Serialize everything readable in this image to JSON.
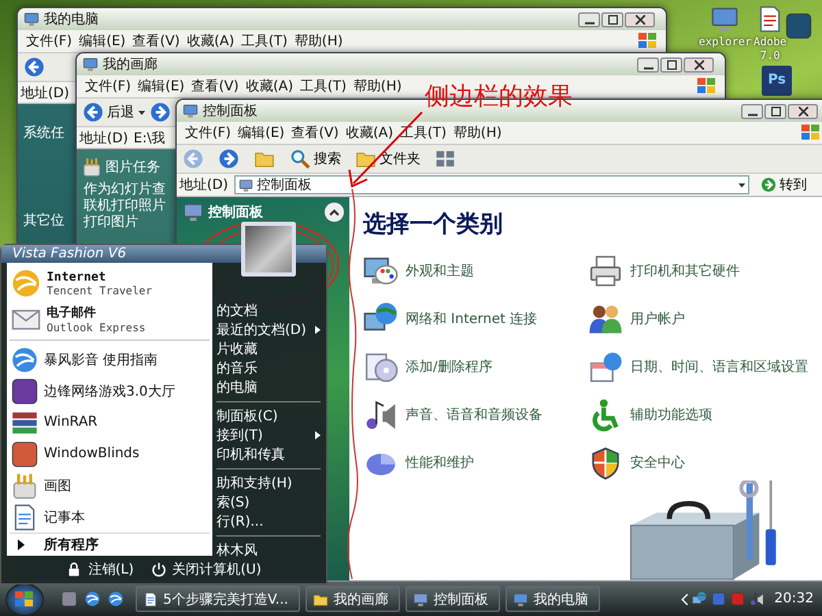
{
  "desktop_icons": [
    {
      "kind": "computer",
      "label": "explorer"
    },
    {
      "kind": "pdf",
      "label": "Adobe",
      "caption": "7.0"
    },
    {
      "kind": "feather"
    },
    {
      "kind": "photoshop",
      "badge": "Ps"
    }
  ],
  "my_computer_window": {
    "title": "我的电脑",
    "menu": [
      "文件(F)",
      "编辑(E)",
      "查看(V)",
      "收藏(A)",
      "工具(T)",
      "帮助(H)"
    ],
    "address_label": "地址(D)",
    "sections": [
      "系统任",
      "其它位"
    ]
  },
  "gallery_window": {
    "title": "我的画廊",
    "menu": [
      "文件(F)",
      "编辑(E)",
      "查看(V)",
      "收藏(A)",
      "工具(T)",
      "帮助(H)"
    ],
    "back_label": "后退",
    "address_label": "地址(D)",
    "address_value": "E:\\我",
    "task_title": "图片任务",
    "tasks": [
      "作为幻灯片查",
      "联机打印照片",
      "打印图片"
    ]
  },
  "control_panel_window": {
    "title": "控制面板",
    "menu": [
      "文件(F)",
      "编辑(E)",
      "查看(V)",
      "收藏(A)",
      "工具(T)",
      "帮助(H)"
    ],
    "toolbar": [
      {
        "kind": "back",
        "disabled": true
      },
      {
        "kind": "forward",
        "disabled": false
      },
      {
        "kind": "up",
        "disabled": false
      },
      {
        "kind": "search",
        "label": "搜索",
        "disabled": false
      },
      {
        "kind": "folders",
        "label": "文件夹",
        "disabled": false
      },
      {
        "kind": "views",
        "disabled": false
      }
    ],
    "address_label": "地址(D)",
    "address_value": "控制面板",
    "go_label": "转到",
    "sidebar_title": "控制面板",
    "heading": "选择一个类别",
    "categories": [
      {
        "kind": "appearance",
        "label": "外观和主题"
      },
      {
        "kind": "printer",
        "label": "打印机和其它硬件"
      },
      {
        "kind": "network",
        "label": "网络和 Internet 连接"
      },
      {
        "kind": "users",
        "label": "用户帐户"
      },
      {
        "kind": "programs",
        "label": "添加/删除程序"
      },
      {
        "kind": "datetime",
        "label": "日期、时间、语言和区域设置"
      },
      {
        "kind": "sound",
        "label": "声音、语音和音频设备"
      },
      {
        "kind": "accessibility",
        "label": "辅助功能选项"
      },
      {
        "kind": "performance",
        "label": "性能和维护"
      },
      {
        "kind": "security",
        "label": "安全中心"
      }
    ]
  },
  "annotation": {
    "text": "侧边栏的效果"
  },
  "start_menu": {
    "header": "Vista Fashion V6",
    "pinned": [
      {
        "kind": "internet",
        "title": "Internet",
        "subtitle": "Tencent Traveler"
      },
      {
        "kind": "mail",
        "title": "电子邮件",
        "subtitle": "Outlook Express"
      }
    ],
    "recent": [
      {
        "kind": "media",
        "label": "暴风影音 使用指南"
      },
      {
        "kind": "game",
        "label": "边锋网络游戏3.0大厅"
      },
      {
        "kind": "winrar",
        "label": "WinRAR"
      },
      {
        "kind": "windowblinds",
        "label": "WindowBlinds"
      },
      {
        "kind": "paint",
        "label": "画图"
      },
      {
        "kind": "notepad",
        "label": "记事本"
      }
    ],
    "all_programs": "所有程序",
    "places": [
      [
        {
          "label": "的文档",
          "submenu": false
        },
        {
          "label": "最近的文档(D)",
          "submenu": true
        },
        {
          "label": "片收藏",
          "submenu": false
        },
        {
          "label": "的音乐",
          "submenu": false
        },
        {
          "label": "的电脑",
          "submenu": false
        }
      ],
      [
        {
          "label": "制面板(C)",
          "submenu": false
        },
        {
          "label": "接到(T)",
          "submenu": true
        },
        {
          "label": "印机和传真",
          "submenu": false
        }
      ],
      [
        {
          "label": "助和支持(H)",
          "submenu": false
        },
        {
          "label": "索(S)",
          "submenu": false
        },
        {
          "label": "行(R)...",
          "submenu": false
        }
      ],
      [
        {
          "label": "林木风",
          "submenu": false
        }
      ]
    ],
    "logoff": "注销(L)",
    "shutdown": "关闭计算机(U)"
  },
  "taskbar": {
    "quick_launch": [
      {
        "kind": "desktop"
      },
      {
        "kind": "media"
      },
      {
        "kind": "ie"
      }
    ],
    "tasks": [
      {
        "kind": "doc",
        "label": "5个步骤完美打造V..."
      },
      {
        "kind": "folder",
        "label": "我的画廊"
      },
      {
        "kind": "panel",
        "label": "控制面板"
      },
      {
        "kind": "computer",
        "label": "我的电脑"
      }
    ],
    "tray": [
      {
        "kind": "network"
      },
      {
        "kind": "shield"
      },
      {
        "kind": "antivirus"
      },
      {
        "kind": "volume"
      }
    ],
    "clock": "20:32"
  }
}
